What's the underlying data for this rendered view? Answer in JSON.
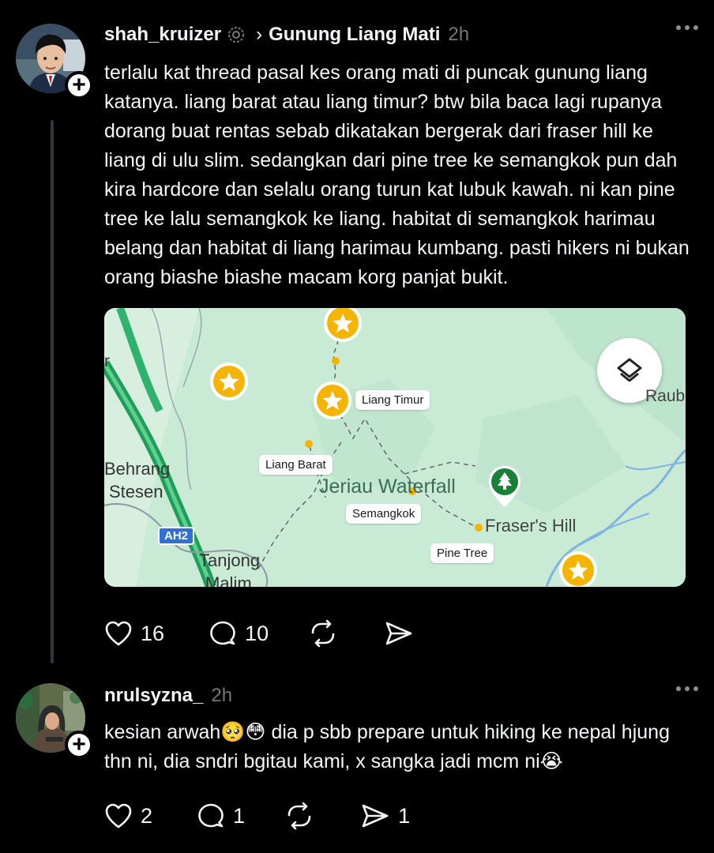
{
  "posts": [
    {
      "username": "shah_kruizer",
      "community": "Gunung Liang Mati",
      "time": "2h",
      "text": "terlalu kat thread pasal kes orang mati di puncak gunung liang katanya. liang barat atau liang timur?  btw bila baca lagi rupanya dorang buat rentas sebab dikatakan bergerak dari fraser hill ke liang di ulu slim. sedangkan dari pine tree ke semangkok pun dah kira hardcore dan selalu orang turun kat lubuk kawah. ni kan pine tree ke lalu semangkok ke liang. habitat di semangkok harimau belang dan habitat di liang harimau kumbang. pasti hikers ni bukan orang biashe biashe macam korg panjat bukit.",
      "likes": "16",
      "replies": "10",
      "reposts": "",
      "shares": ""
    },
    {
      "username": "nrulsyzna_",
      "time": "2h",
      "text": "kesian arwah🥺😳 dia p sbb prepare untuk hiking ke nepal hjung thn ni, dia sndri bgitau kami, x sangka jadi mcm ni😭",
      "likes": "2",
      "replies": "1",
      "reposts": "",
      "shares": "1"
    }
  ],
  "map": {
    "labels": {
      "liang_timur": "Liang Timur",
      "liang_barat": "Liang Barat",
      "semangkok": "Semangkok",
      "pine_tree": "Pine Tree"
    },
    "places": {
      "behrang": "Behrang",
      "stesen": "Stesen",
      "tanjong": "Tanjong",
      "malim": "Malim",
      "jeriau": "Jeriau Waterfall",
      "frasers_hill": "Fraser's Hill",
      "raub": "Raub",
      "edge_r": "r",
      "highway": "AH2"
    }
  },
  "colors": {
    "background": "#000000",
    "text": "#f3f5f7",
    "muted": "#777777",
    "star_marker": "#f4b400",
    "park_marker": "#188038"
  },
  "icons": [
    "avatar",
    "plus-icon",
    "verified-icon",
    "chevron-right-icon",
    "more-icon",
    "heart-icon",
    "comment-icon",
    "repost-icon",
    "share-icon",
    "layers-icon",
    "star-marker-icon",
    "tree-marker-icon"
  ]
}
